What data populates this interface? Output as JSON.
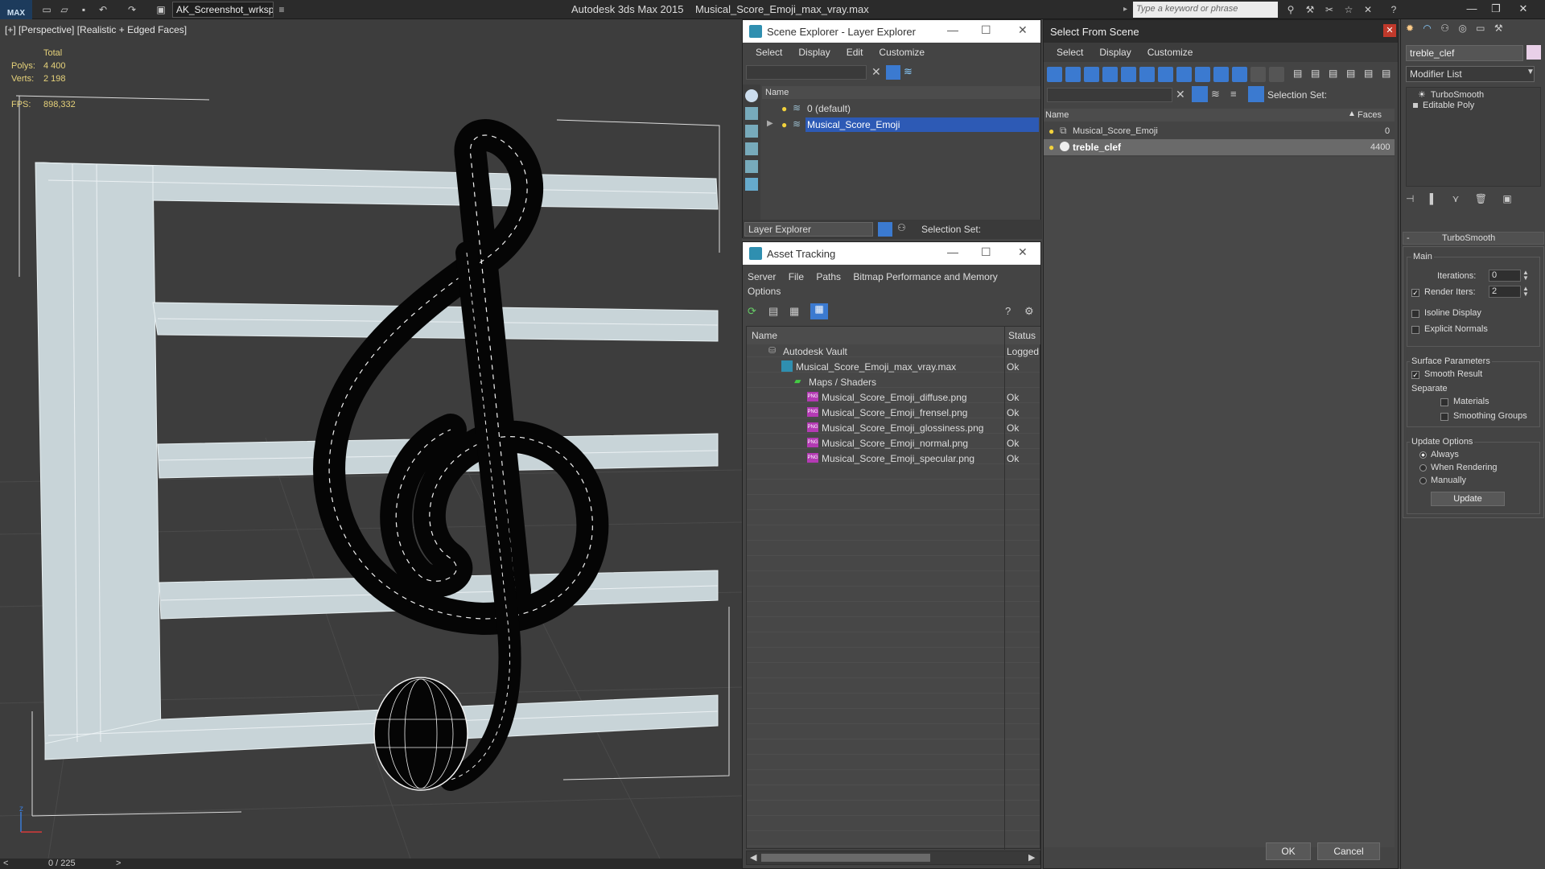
{
  "titlebar": {
    "logo": "MAX",
    "workspace": "AK_Screenshot_wrksp",
    "app_name": "Autodesk 3ds Max  2015",
    "file_name": "Musical_Score_Emoji_max_vray.max",
    "search_placeholder": "Type a keyword or phrase"
  },
  "viewport": {
    "label": "[+] [Perspective] [Realistic + Edged Faces]",
    "stats": {
      "total_label": "Total",
      "polys_label": "Polys:",
      "polys_value": "4 400",
      "verts_label": "Verts:",
      "verts_value": "2 198",
      "fps_label": "FPS:",
      "fps_value": "898,332"
    },
    "axis_z": "z",
    "timeline": "0 / 225",
    "timeline_prev": "<",
    "timeline_next": ">"
  },
  "scene_explorer": {
    "title": "Scene Explorer - Layer Explorer",
    "menu": [
      "Select",
      "Display",
      "Edit",
      "Customize"
    ],
    "column_name": "Name",
    "rows": [
      {
        "label": "0 (default)",
        "selected": false
      },
      {
        "label": "Musical_Score_Emoji",
        "selected": true
      }
    ],
    "footer_dropdown": "Layer Explorer",
    "footer_selection": "Selection Set:"
  },
  "asset_tracking": {
    "title": "Asset Tracking",
    "menu": [
      "Server",
      "File",
      "Paths",
      "Bitmap Performance and Memory"
    ],
    "menu2": "Options",
    "col_name": "Name",
    "col_status": "Status",
    "rows": [
      {
        "name": "Autodesk Vault",
        "status": "Logged",
        "indent": 1,
        "icon": "vault-icon"
      },
      {
        "name": "Musical_Score_Emoji_max_vray.max",
        "status": "Ok",
        "indent": 2,
        "icon": "max-file-icon"
      },
      {
        "name": "Maps / Shaders",
        "status": "",
        "indent": 3,
        "icon": "maps-folder-icon"
      },
      {
        "name": "Musical_Score_Emoji_diffuse.png",
        "status": "Ok",
        "indent": 4,
        "icon": "png-icon"
      },
      {
        "name": "Musical_Score_Emoji_frensel.png",
        "status": "Ok",
        "indent": 4,
        "icon": "png-icon"
      },
      {
        "name": "Musical_Score_Emoji_glossiness.png",
        "status": "Ok",
        "indent": 4,
        "icon": "png-icon"
      },
      {
        "name": "Musical_Score_Emoji_normal.png",
        "status": "Ok",
        "indent": 4,
        "icon": "png-icon"
      },
      {
        "name": "Musical_Score_Emoji_specular.png",
        "status": "Ok",
        "indent": 4,
        "icon": "png-icon"
      }
    ],
    "png_badge": "PNG"
  },
  "select_from_scene": {
    "title": "Select From Scene",
    "menu": [
      "Select",
      "Display",
      "Customize"
    ],
    "selection_set": "Selection Set:",
    "col_name": "Name",
    "col_faces": "Faces",
    "rows": [
      {
        "name": "Musical_Score_Emoji",
        "faces": "0",
        "selected": false
      },
      {
        "name": "treble_clef",
        "faces": "4400",
        "selected": true
      }
    ],
    "ok": "OK",
    "cancel": "Cancel"
  },
  "command_panel": {
    "object_name": "treble_clef",
    "modifier_list": "Modifier List",
    "stack": [
      "TurboSmooth",
      "Editable Poly"
    ],
    "rollout_title": "TurboSmooth",
    "rollout_collapse": "-",
    "main_label": "Main",
    "iterations_label": "Iterations:",
    "iterations_value": "0",
    "render_iters_label": "Render Iters:",
    "render_iters_value": "2",
    "render_iters_checked": true,
    "isoline_label": "Isoline Display",
    "explicit_normals_label": "Explicit Normals",
    "surface_params_label": "Surface Parameters",
    "smooth_result_label": "Smooth Result",
    "separate_label": "Separate",
    "materials_label": "Materials",
    "smoothing_groups_label": "Smoothing Groups",
    "update_options_label": "Update Options",
    "always_label": "Always",
    "when_rendering_label": "When Rendering",
    "manually_label": "Manually",
    "update_button": "Update"
  },
  "colors": {
    "selection": "#2d5ab5",
    "staff_fill": "#c8d4d8",
    "clef_fill": "#050505",
    "stats_text": "#e6d27a"
  }
}
